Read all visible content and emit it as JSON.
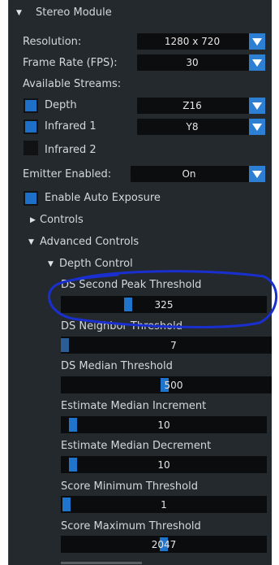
{
  "header": {
    "title": "Stereo Module"
  },
  "controls": {
    "resolution": {
      "label": "Resolution:",
      "value": "1280 x 720"
    },
    "frame_rate": {
      "label": "Frame Rate (FPS):",
      "value": "30"
    },
    "streams_label": "Available Streams:",
    "streams": [
      {
        "label": "Depth",
        "format": "Z16",
        "enabled": true
      },
      {
        "label": "Infrared 1",
        "format": "Y8",
        "enabled": true
      },
      {
        "label": "Infrared 2",
        "enabled": false
      }
    ],
    "emitter": {
      "label": "Emitter Enabled:",
      "value": "On"
    },
    "auto_exposure": {
      "label": "Enable Auto Exposure",
      "enabled": true
    },
    "controls_section": "Controls",
    "advanced_section": "Advanced Controls",
    "depth_control": "Depth Control"
  },
  "sliders": [
    {
      "label": "DS Second Peak Threshold",
      "value": "325",
      "level": 0.3
    },
    {
      "label": "DS Neighbor Threshold",
      "value": "7",
      "level": 0.0
    },
    {
      "label": "DS Median Threshold",
      "value": "500",
      "level": 0.45
    },
    {
      "label": "Estimate Median Increment",
      "value": "10",
      "level": 0.04
    },
    {
      "label": "Estimate Median Decrement",
      "value": "10",
      "level": 0.04
    },
    {
      "label": "Score Minimum Threshold",
      "value": "1",
      "level": 0.01
    },
    {
      "label": "Score Maximum Threshold",
      "value": "2047",
      "level": 0.5
    }
  ],
  "colors": {
    "panel_bg": "#24292d",
    "accent": "#1f74cc",
    "field_bg": "#0b0c0d",
    "annotation": "#1a2fd0"
  }
}
